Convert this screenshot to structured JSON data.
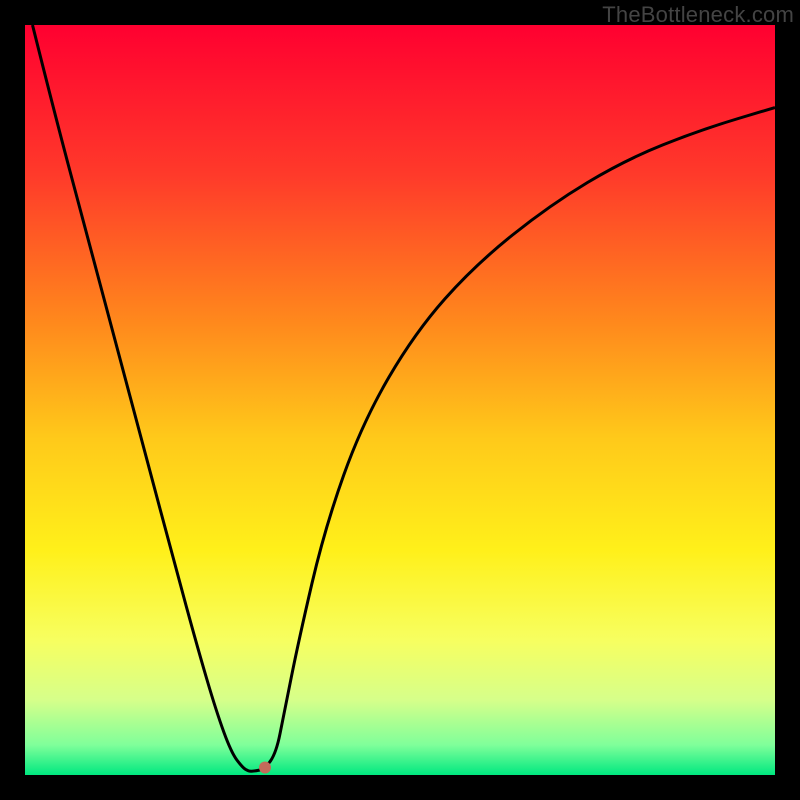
{
  "watermark": "TheBottleneck.com",
  "chart_data": {
    "type": "line",
    "title": "",
    "xlabel": "",
    "ylabel": "",
    "xlim": [
      0,
      1
    ],
    "ylim": [
      0,
      1
    ],
    "background": {
      "type": "vertical-gradient",
      "stops": [
        {
          "pos": 0.0,
          "color": "#ff0030"
        },
        {
          "pos": 0.2,
          "color": "#ff3a2a"
        },
        {
          "pos": 0.4,
          "color": "#ff8a1c"
        },
        {
          "pos": 0.55,
          "color": "#ffc91a"
        },
        {
          "pos": 0.7,
          "color": "#fff01a"
        },
        {
          "pos": 0.82,
          "color": "#f7ff60"
        },
        {
          "pos": 0.9,
          "color": "#d6ff8a"
        },
        {
          "pos": 0.96,
          "color": "#7fff9a"
        },
        {
          "pos": 1.0,
          "color": "#00e880"
        }
      ]
    },
    "series": [
      {
        "name": "bottleneck-curve",
        "color": "#000000",
        "stroke_width": 3,
        "x": [
          0.01,
          0.04,
          0.08,
          0.12,
          0.16,
          0.2,
          0.23,
          0.255,
          0.275,
          0.29,
          0.298,
          0.305,
          0.32,
          0.335,
          0.345,
          0.365,
          0.4,
          0.45,
          0.52,
          0.6,
          0.7,
          0.8,
          0.9,
          1.0
        ],
        "y": [
          1.0,
          0.88,
          0.73,
          0.58,
          0.43,
          0.28,
          0.17,
          0.085,
          0.03,
          0.01,
          0.005,
          0.005,
          0.008,
          0.03,
          0.08,
          0.18,
          0.33,
          0.47,
          0.59,
          0.68,
          0.76,
          0.82,
          0.86,
          0.89
        ]
      }
    ],
    "marker": {
      "name": "minimum-point",
      "x": 0.32,
      "y": 0.01,
      "r": 6,
      "color": "#c46a5a"
    }
  }
}
